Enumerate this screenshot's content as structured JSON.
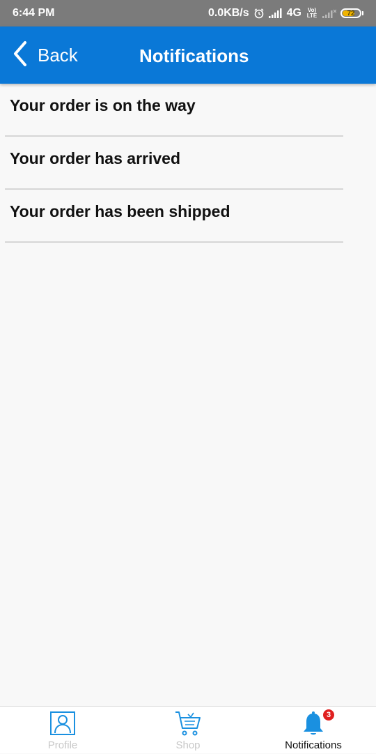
{
  "status_bar": {
    "time": "6:44 PM",
    "network_speed": "0.0KB/s",
    "network_type": "4G",
    "volte_top": "Vo)",
    "volte_bottom": "LTE",
    "battery_level": "72",
    "battery_fraction": 0.72,
    "icons": [
      "alarm-icon",
      "signal-icon",
      "signal-weak-icon",
      "battery-icon"
    ]
  },
  "header": {
    "back_label": "Back",
    "title": "Notifications",
    "background": "#0a78d7"
  },
  "notifications": [
    {
      "text": "Your order is on the way"
    },
    {
      "text": "Your order has arrived"
    },
    {
      "text": "Your order has been shipped"
    }
  ],
  "bottom_nav": {
    "tabs": [
      {
        "label": "Profile",
        "icon": "profile-icon",
        "active": false
      },
      {
        "label": "Shop",
        "icon": "cart-icon",
        "active": false
      },
      {
        "label": "Notifications",
        "icon": "bell-icon",
        "active": true,
        "badge": "3"
      }
    ],
    "accent": "#1a90e0",
    "badge_color": "#e02020"
  }
}
